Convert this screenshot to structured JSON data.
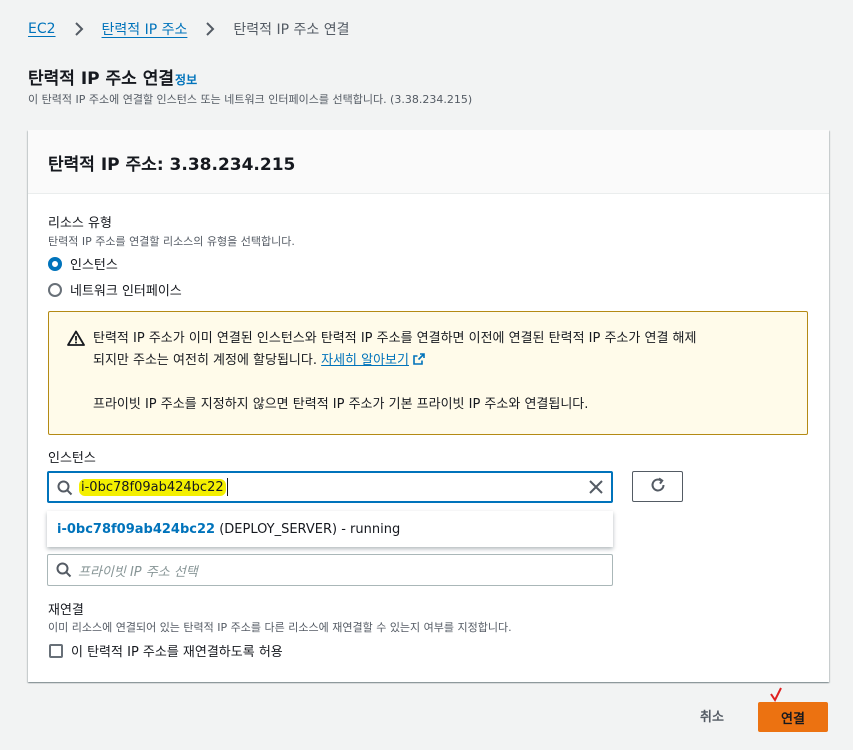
{
  "breadcrumb": {
    "items": [
      "EC2",
      "탄력적 IP 주소",
      "탄력적 IP 주소 연결"
    ]
  },
  "page": {
    "title": "탄력적 IP 주소 연결",
    "info": "정보",
    "description": "이 탄력적 IP 주소에 연결할 인스턴스 또는 네트워크 인터페이스를 선택합니다. (3.38.234.215)"
  },
  "panel": {
    "title": "탄력적 IP 주소: 3.38.234.215",
    "resource_type_label": "리소스 유형",
    "resource_type_desc": "탄력적 IP 주소를 연결할 리소스의 유형을 선택합니다.",
    "options": [
      "인스턴스",
      "네트워크 인터페이스"
    ],
    "selected_option": "인스턴스"
  },
  "alert": {
    "text1": "탄력적 IP 주소가 이미 연결된 인스턴스와 탄력적 IP 주소를 연결하면 이전에 연결된 탄력적 IP 주소가 연결 해제",
    "text2": "되지만 주소는 여전히 계정에 할당됩니다.",
    "link": "자세히 알아보기",
    "text3": "프라이빗 IP 주소를 지정하지 않으면 탄력적 IP 주소가 기본 프라이빗 IP 주소와 연결됩니다."
  },
  "instance": {
    "label": "인스턴스",
    "search_value": "i-0bc78f09ab424bc22",
    "dropdown_id": "i-0bc78f09ab424bc22",
    "dropdown_rest": " (DEPLOY_SERVER) - running"
  },
  "private_ip": {
    "placeholder": "프라이빗 IP 주소 선택"
  },
  "reassociation": {
    "label": "재연결",
    "desc": "이미 리소스에 연결되어 있는 탄력적 IP 주소를 다른 리소스에 재연결할 수 있는지 여부를 지정합니다.",
    "checkbox_label": "이 탄력적 IP 주소를 재연결하도록 허용"
  },
  "footer": {
    "cancel": "취소",
    "connect": "연결"
  },
  "colors": {
    "primary": "#ec7211",
    "link": "#0073bb",
    "highlight": "#f4ef00",
    "annotation": "#e02020"
  }
}
